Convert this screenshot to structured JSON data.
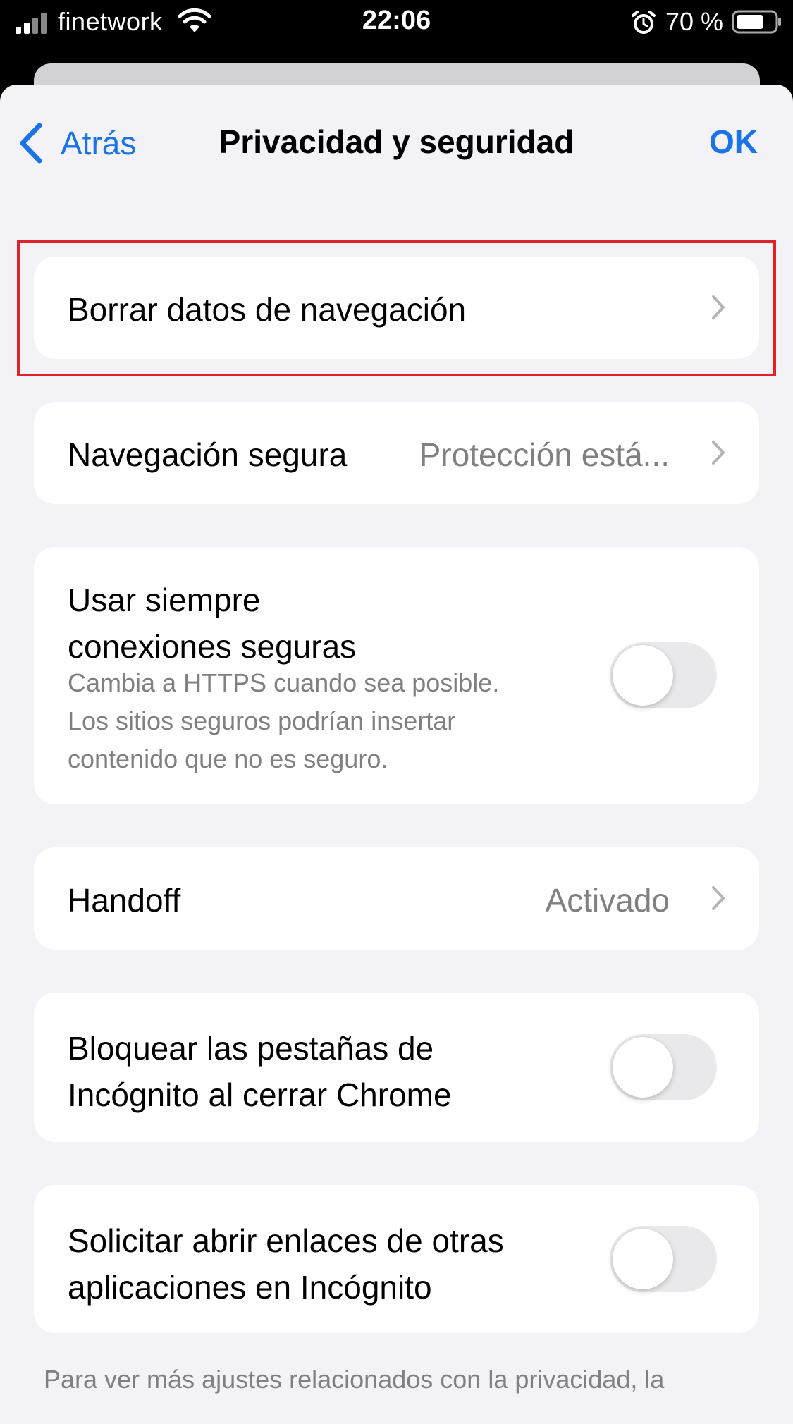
{
  "status_bar": {
    "carrier": "finetwork",
    "time": "22:06",
    "battery": "70 %"
  },
  "nav": {
    "back_label": "Atrás",
    "title": "Privacidad y seguridad",
    "done_label": "OK"
  },
  "rows": {
    "clear_data": {
      "title": "Borrar datos de navegación"
    },
    "safe_browsing": {
      "title": "Navegación segura",
      "value": "Protección está..."
    },
    "https": {
      "title_line1": "Usar siempre",
      "title_line2": "conexiones seguras",
      "subtitle_line1": "Cambia a HTTPS cuando sea posible.",
      "subtitle_line2": "Los sitios seguros podrían insertar",
      "subtitle_line3": "contenido que no es seguro.",
      "toggle_on": false
    },
    "handoff": {
      "title": "Handoff",
      "value": "Activado"
    },
    "lock_incognito": {
      "title_line1": "Bloquear las pestañas de",
      "title_line2": "Incógnito al cerrar Chrome",
      "toggle_on": false
    },
    "open_links_incognito": {
      "title_line1": "Solicitar abrir enlaces de otras",
      "title_line2": "aplicaciones en Incógnito",
      "toggle_on": false
    }
  },
  "footer": {
    "text": "Para ver más ajustes relacionados con la privacidad, la"
  },
  "colors": {
    "accent": "#1a73e8",
    "highlight": "#e0222b",
    "background": "#f2f2f7"
  }
}
